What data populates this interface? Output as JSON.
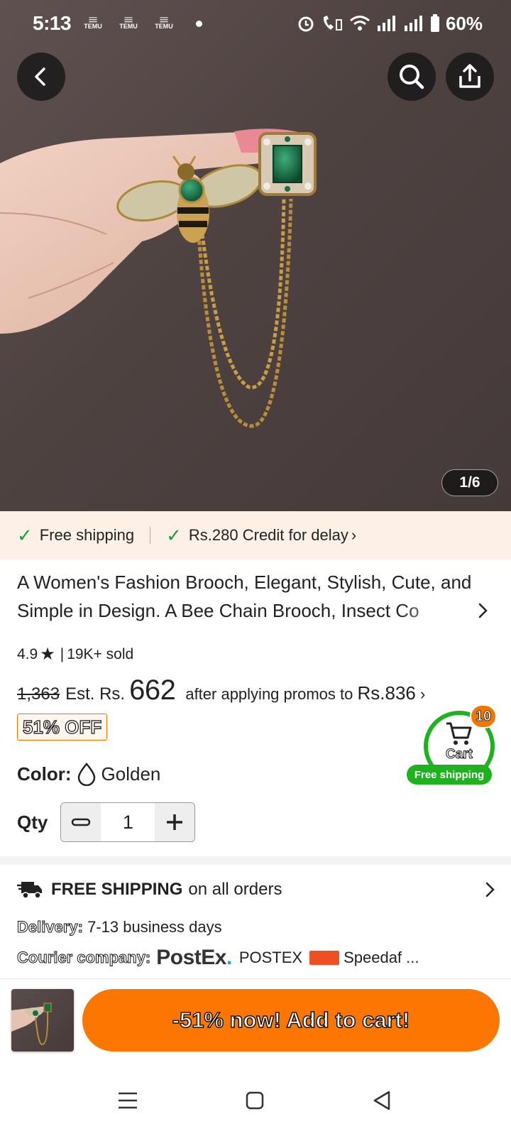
{
  "status_bar": {
    "time": "5:13",
    "notif_app_1": "TEMU",
    "notif_app_2": "TEMU",
    "notif_app_3": "TEMU",
    "battery": "60%"
  },
  "gallery": {
    "counter": "1/6"
  },
  "shipping_strip": {
    "free_shipping": "Free shipping",
    "credit": "Rs.280 Credit for delay"
  },
  "product": {
    "title": "A Women's Fashion Brooch, Elegant, Stylish, Cute, and Simple in Design. A Bee Chain Brooch, Insect Co",
    "rating": "4.9",
    "sold": "19K+ sold",
    "original_price": "1,363",
    "est_label": "Est. Rs.",
    "price": "662",
    "promo_text": "after applying promos to",
    "promo_price": "Rs.836",
    "discount_badge": "51% OFF",
    "color_label": "Color:",
    "color_value": "Golden",
    "qty_label": "Qty",
    "qty_value": "1"
  },
  "cart_float": {
    "count": "10",
    "label": "Cart",
    "subtitle": "Free shipping"
  },
  "shipping_info": {
    "headline_bold": "FREE SHIPPING",
    "headline_rest": "on all orders",
    "delivery_label": "Delivery:",
    "delivery_value": "7-13 business days",
    "courier_label": "Courier company:",
    "courier_logo_1": "PostEx",
    "courier_1": "POSTEX",
    "courier_2": "Speedaf ..."
  },
  "bottom_bar": {
    "add_to_cart": "-51% now! Add to cart!"
  },
  "colors": {
    "accent_orange": "#fb7701",
    "badge_orange": "#f07800",
    "check_green": "#1a9e3a",
    "cart_green": "#1fb21f",
    "strip_bg": "#fdf0e6"
  }
}
